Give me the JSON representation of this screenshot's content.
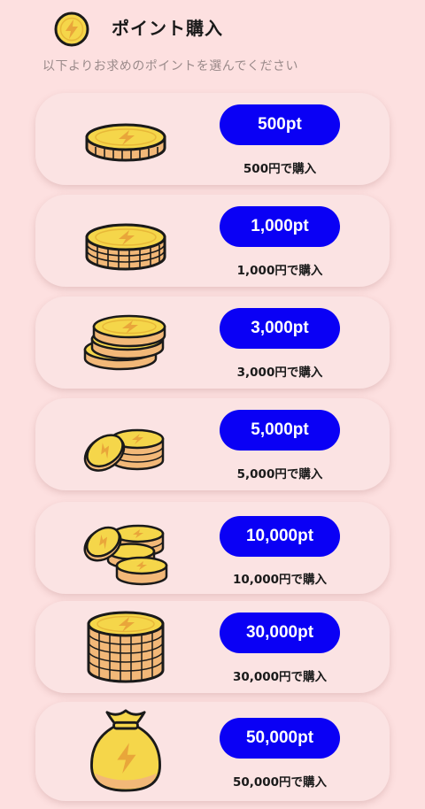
{
  "header": {
    "title": "ポイント購入",
    "icon": "lightning-coin-icon",
    "subtitle": "以下よりお求めのポイントを選んでください"
  },
  "colors": {
    "background": "#fde0e0",
    "card": "#fbe3e3",
    "button": "#0a00f5",
    "coin": "#f5d64a",
    "coin_edge": "#f2b878"
  },
  "packages": [
    {
      "points": "500pt",
      "price": "500円で購入",
      "art": "single-coin-icon"
    },
    {
      "points": "1,000pt",
      "price": "1,000円で購入",
      "art": "coin-stack-icon"
    },
    {
      "points": "3,000pt",
      "price": "3,000円で購入",
      "art": "coin-pile-icon"
    },
    {
      "points": "5,000pt",
      "price": "5,000円で購入",
      "art": "coins-with-stack-icon"
    },
    {
      "points": "10,000pt",
      "price": "10,000円で購入",
      "art": "coins-scattered-icon"
    },
    {
      "points": "30,000pt",
      "price": "30,000円で購入",
      "art": "tall-coin-stack-icon"
    },
    {
      "points": "50,000pt",
      "price": "50,000円で購入",
      "art": "money-bag-icon"
    }
  ]
}
